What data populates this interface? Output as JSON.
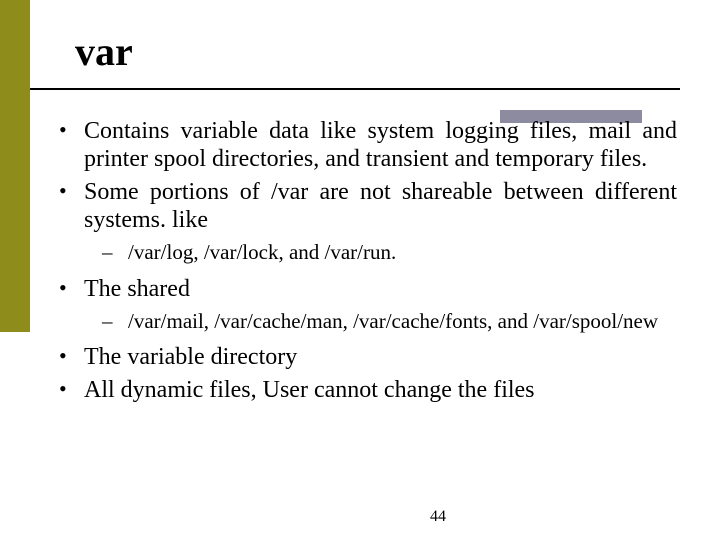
{
  "title": "var",
  "bullets": {
    "b1": "Contains variable data like system logging files, mail and printer spool directories, and transient and temporary files.",
    "b2": "Some portions of /var are not shareable between different systems. like",
    "b2_sub": "/var/log, /var/lock, and /var/run.",
    "b3": "The shared",
    "b3_sub": " /var/mail, /var/cache/man, /var/cache/fonts, and /var/spool/new",
    "b4": "The variable directory",
    "b5": "All dynamic files, User cannot change the files"
  },
  "page_number": "44"
}
